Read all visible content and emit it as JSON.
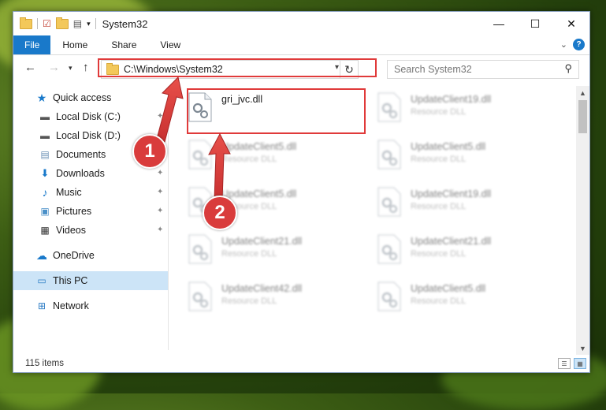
{
  "window": {
    "title": "System32",
    "controls": {
      "minimize": "—",
      "maximize": "☐",
      "close": "✕"
    }
  },
  "ribbon": {
    "tabs": [
      "File",
      "Home",
      "Share",
      "View"
    ],
    "help": "?"
  },
  "nav": {
    "address_path": "C:\\Windows\\System32",
    "search_placeholder": "Search System32"
  },
  "sidebar": {
    "items": [
      {
        "label": "Quick access",
        "icon": "star-icon",
        "pinned": false
      },
      {
        "label": "Local Disk (C:)",
        "icon": "drive-icon",
        "pinned": true
      },
      {
        "label": "Local Disk (D:)",
        "icon": "drive-icon",
        "pinned": true
      },
      {
        "label": "Documents",
        "icon": "documents-icon",
        "pinned": true
      },
      {
        "label": "Downloads",
        "icon": "downloads-icon",
        "pinned": true
      },
      {
        "label": "Music",
        "icon": "music-icon",
        "pinned": true
      },
      {
        "label": "Pictures",
        "icon": "pictures-icon",
        "pinned": true
      },
      {
        "label": "Videos",
        "icon": "videos-icon",
        "pinned": true
      },
      {
        "label": "OneDrive",
        "icon": "onedrive-icon",
        "pinned": false
      },
      {
        "label": "This PC",
        "icon": "computer-icon",
        "pinned": false,
        "selected": true
      },
      {
        "label": "Network",
        "icon": "network-icon",
        "pinned": false
      }
    ]
  },
  "files": [
    {
      "name": "gri_jvc.dll",
      "type": "",
      "highlighted": true
    },
    {
      "name": "UpdateClient19.dll",
      "type": "Resource DLL"
    },
    {
      "name": "UpdateClient5.dll",
      "type": "Resource DLL"
    },
    {
      "name": "UpdateClient5.dll",
      "type": "Resource DLL"
    },
    {
      "name": "UpdateClient5.dll",
      "type": "Resource DLL"
    },
    {
      "name": "UpdateClient19.dll",
      "type": "Resource DLL"
    },
    {
      "name": "UpdateClient21.dll",
      "type": "Resource DLL"
    },
    {
      "name": "UpdateClient21.dll",
      "type": "Resource DLL"
    },
    {
      "name": "UpdateClient42.dll",
      "type": "Resource DLL"
    },
    {
      "name": "UpdateClient5.dll",
      "type": "Resource DLL"
    }
  ],
  "status": {
    "item_count": "115 items"
  },
  "annotations": {
    "badge_1": "1",
    "badge_2": "2"
  },
  "colors": {
    "accent": "#1979ca",
    "annotation_red": "#e03a3a",
    "selected_bg": "#cce4f7"
  }
}
